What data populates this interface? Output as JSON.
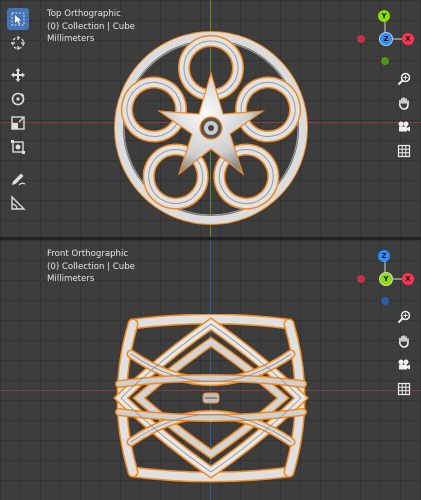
{
  "colors": {
    "grid_bg": "#3d3d3d",
    "axis_red": "#ff3352",
    "axis_green": "#8bdc00",
    "axis_blue": "#2890ff",
    "selection_orange": "#f08a20",
    "active_tool": "#4772b3"
  },
  "viewports": {
    "top": {
      "view_name": "Top Orthographic",
      "collection": "(0) Collection | Cube",
      "units": "Millimeters",
      "gizmo": {
        "y_label": "Y",
        "z_label": "Z",
        "x_label": "X"
      }
    },
    "front": {
      "view_name": "Front Orthographic",
      "collection": "(0) Collection | Cube",
      "units": "Millimeters",
      "gizmo": {
        "z_label": "Z",
        "y_label": "Y",
        "x_label": "X"
      }
    }
  },
  "toolbar": {
    "tools": [
      "select-box",
      "cursor",
      "move",
      "rotate",
      "scale",
      "transform",
      "annotate",
      "measure"
    ]
  },
  "navigation": {
    "buttons": [
      "zoom",
      "pan",
      "camera",
      "perspective-grid"
    ]
  }
}
